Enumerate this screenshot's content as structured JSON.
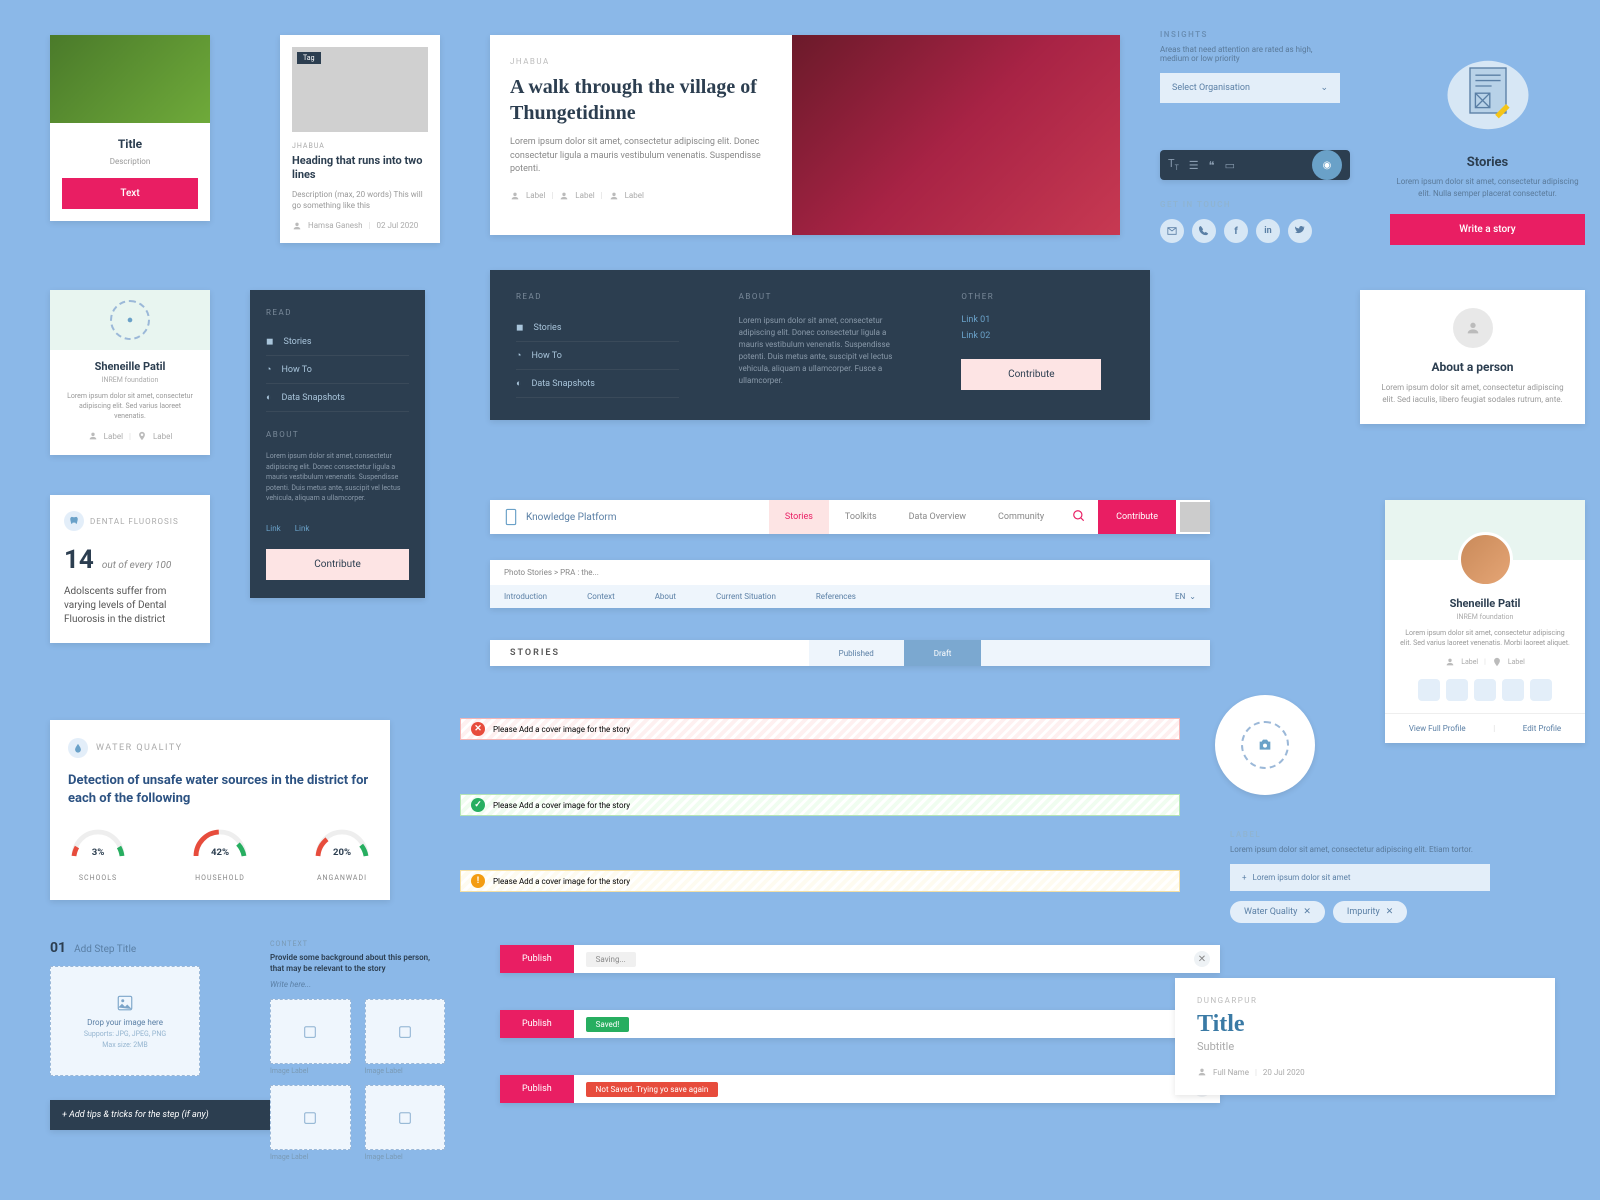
{
  "card1": {
    "title": "Title",
    "desc": "Description",
    "btn": "Text"
  },
  "card2": {
    "tag": "Tag",
    "location": "JHABUA",
    "heading": "Heading that runs into two lines",
    "desc": "Description (max, 20 words) This will go something like this",
    "author": "Hamsa Ganesh",
    "date": "02 Jul 2020"
  },
  "hero": {
    "location": "JHABUA",
    "title": "A walk through the village of Thungetidinne",
    "body": "Lorem ipsum dolor sit amet, consectetur adipiscing elit. Donec consectetur ligula a mauris vestibulum venenatis. Suspendisse potenti.",
    "labels": [
      "Label",
      "Label",
      "Label"
    ]
  },
  "insights": {
    "label": "INSIGHTS",
    "desc": "Areas that need attention are rated as high, medium or low priority",
    "select": "Select Organisation"
  },
  "getintouch": {
    "label": "GET IN TOUCH"
  },
  "stories": {
    "title": "Stories",
    "desc": "Lorem ipsum dolor sit amet, consectetur adipiscing elit. Nulla semper placerat consectetur.",
    "btn": "Write a story"
  },
  "profile1": {
    "name": "Sheneille Patil",
    "org": "INREM foundation",
    "bio": "Lorem ipsum dolor sit amet, consectetur adipiscing elit. Sed varius laoreet venenatis.",
    "label1": "Label",
    "label2": "Label"
  },
  "sidebar": {
    "read": "READ",
    "items": [
      "Stories",
      "How To",
      "Data Snapshots"
    ],
    "about_label": "ABOUT",
    "about_txt": "Lorem ipsum dolor sit amet, consectetur adipiscing elit. Donec consectetur ligula a mauris vestibulum venenatis. Suspendisse potenti. Duis metus ante, suscipit vel lectus vehicula, aliquam a ullamcorper.",
    "link": "Link",
    "btn": "Contribute"
  },
  "footer": {
    "read": "READ",
    "items": [
      "Stories",
      "How To",
      "Data Snapshots"
    ],
    "about": "ABOUT",
    "about_txt": "Lorem ipsum dolor sit amet, consectetur adipiscing elit. Donec consectetur ligula a mauris vestibulum venenatis. Suspendisse potenti. Duis metus ante, suscipit vel lectus vehicula, aliquam a ullamcorper. Fusce a ullamcorper.",
    "other": "OTHER",
    "links": [
      "Link 01",
      "Link 02"
    ],
    "btn": "Contribute"
  },
  "aboutperson": {
    "title": "About a person",
    "desc": "Lorem ipsum dolor sit amet, consectetur adipiscing elit. Sed iaculis, libero feugiat sodales rutrum, ante."
  },
  "stat": {
    "badge": "DENTAL FLUOROSIS",
    "num": "14",
    "per": "out of every 100",
    "txt": "Adolscents suffer from varying levels of Dental Fluorosis in the district"
  },
  "navbar": {
    "brand": "Knowledge Platform",
    "items": [
      "Stories",
      "Toolkits",
      "Data Overview",
      "Community"
    ],
    "cta": "Contribute"
  },
  "breadbar": {
    "crumb": "Photo Stories > PRA : the...",
    "subnav": [
      "Introduction",
      "Context",
      "About",
      "Current Situation",
      "References"
    ],
    "lang": "EN"
  },
  "tabs": {
    "label": "STORIES",
    "pub": "Published",
    "draft": "Draft"
  },
  "alerts": {
    "err": "Please Add a cover image for the story",
    "ok": "Please Add a cover image for the story",
    "warn": "Please Add a cover image for the story"
  },
  "profile2": {
    "name": "Sheneille Patil",
    "org": "INREM foundation",
    "bio": "Lorem ipsum dolor sit amet, consectetur adipiscing elit. Sed varius laoreet venenatis. Morbi laoreet aliquet.",
    "label1": "Label",
    "label2": "Label",
    "view": "View Full Profile",
    "edit": "Edit Profile"
  },
  "water": {
    "label": "WATER QUALITY",
    "title": "Detection of unsafe water sources in the district for each of the following",
    "g1_val": "3%",
    "g1_label": "SCHOOLS",
    "g2_val": "42%",
    "g2_label": "HOUSEHOLD",
    "g3_val": "20%",
    "g3_label": "ANGANWADI"
  },
  "addstep": {
    "num": "01",
    "title": "Add Step Title",
    "drop1": "Drop your image here",
    "drop2": "Supports: JPG, JPEG, PNG",
    "drop3": "Max size: 2MB"
  },
  "tips": "+ Add tips & tricks for the step (if any)",
  "content": {
    "label": "CONTEXT",
    "prompt": "Provide some background about this person, that may be relevant to the story",
    "placeholder": "Write here...",
    "caption": "Image Label"
  },
  "publish": {
    "btn": "Publish",
    "saving": "Saving...",
    "saved": "Saved!",
    "notsaved": "Not Saved. Trying yo save again"
  },
  "labelinput": {
    "label": "LABEL",
    "desc": "Lorem ipsum dolor sit amet, consectetur adipiscing elit. Etiam tortor.",
    "placeholder": "Lorem ipsum dolor sit amet",
    "tags": [
      "Water Quality",
      "Impurity"
    ]
  },
  "titlecard": {
    "loc": "DUNGARPUR",
    "title": "Title",
    "sub": "Subtitle",
    "author": "Full Name",
    "date": "20 Jul 2020"
  },
  "chart_data": {
    "type": "bar",
    "series": [
      {
        "name": "SCHOOLS",
        "value": 3
      },
      {
        "name": "HOUSEHOLD",
        "value": 42
      },
      {
        "name": "ANGANWADI",
        "value": 20
      }
    ],
    "title": "Detection of unsafe water sources in the district for each of the following",
    "unit": "%"
  }
}
